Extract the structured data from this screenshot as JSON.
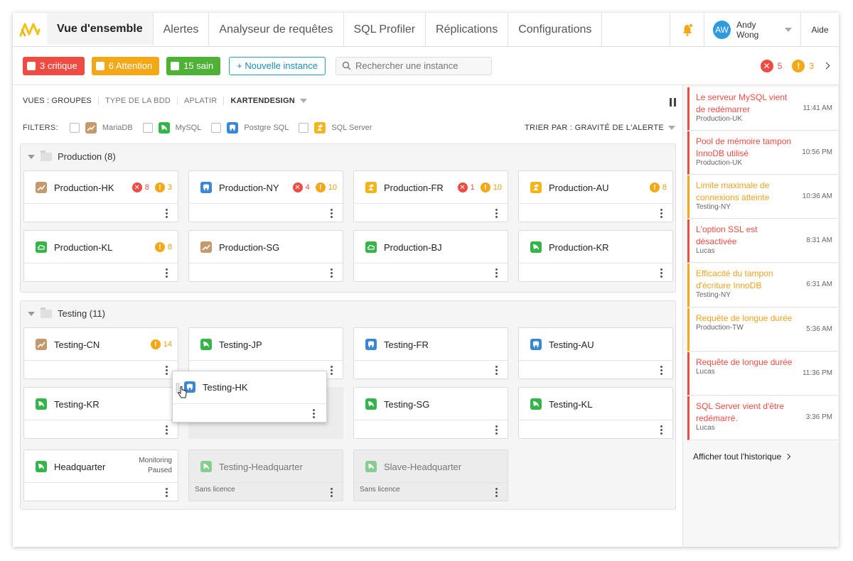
{
  "nav": {
    "tabs": [
      "Vue d'ensemble",
      "Alertes",
      "Analyseur de requêtes",
      "SQL Profiler",
      "Réplications",
      "Configurations"
    ],
    "user_initials": "AW",
    "user_name": "Andy Wong",
    "help": "Aide"
  },
  "toolbar": {
    "critical": "3 critique",
    "attention": "6 Attention",
    "healthy": "15 sain",
    "new_instance": "+ Nouvelle instance",
    "search_placeholder": "Rechercher une instance",
    "err_count": "5",
    "warn_count": "3"
  },
  "views": {
    "items": [
      "VUES : GROUPES",
      "TYPE DE LA BDD",
      "APLATIR",
      "KARTENDESIGN"
    ],
    "filters_label": "FILTERS:",
    "filters": [
      "MariaDB",
      "MySQL",
      "Postgre SQL",
      "SQL Server"
    ],
    "sort": "TRIER PAR : GRAVITÉ DE L'ALERTE"
  },
  "groups": [
    {
      "title": "Production (8)",
      "cards": [
        {
          "name": "Production-HK",
          "db": "mariadb",
          "err": "8",
          "warn": "3"
        },
        {
          "name": "Production-NY",
          "db": "postgres",
          "err": "4",
          "warn": "10"
        },
        {
          "name": "Production-FR",
          "db": "sqlserver",
          "err": "1",
          "warn": "10"
        },
        {
          "name": "Production-AU",
          "db": "sqlserver",
          "err": "",
          "warn": "8"
        },
        {
          "name": "Production-KL",
          "db": "cloud",
          "err": "",
          "warn": "8"
        },
        {
          "name": "Production-SG",
          "db": "mariadb",
          "err": "",
          "warn": ""
        },
        {
          "name": "Production-BJ",
          "db": "cloud",
          "err": "",
          "warn": ""
        },
        {
          "name": "Production-KR",
          "db": "mysql",
          "err": "",
          "warn": ""
        }
      ]
    },
    {
      "title": "Testing (11)",
      "cards": [
        {
          "name": "Testing-CN",
          "db": "mariadb",
          "err": "",
          "warn": "14"
        },
        {
          "name": "Testing-JP",
          "db": "mysql",
          "err": "",
          "warn": ""
        },
        {
          "name": "Testing-FR",
          "db": "postgres",
          "err": "",
          "warn": ""
        },
        {
          "name": "Testing-AU",
          "db": "postgres",
          "err": "",
          "warn": ""
        },
        {
          "name": "Testing-KR",
          "db": "mysql",
          "err": "",
          "warn": ""
        },
        {
          "name": "Testing-SG",
          "db": "mysql",
          "err": "",
          "warn": ""
        },
        {
          "name": "Testing-KL",
          "db": "mysql",
          "err": "",
          "warn": ""
        },
        {
          "name": "Headquarter",
          "db": "mysql",
          "err": "",
          "warn": "",
          "paused": [
            "Monitoring",
            "Paused"
          ]
        },
        {
          "name": "Testing-Headquarter",
          "db": "mysql",
          "disabled": true,
          "note": "Sans licence"
        },
        {
          "name": "Slave-Headquarter",
          "db": "mysql",
          "disabled": true,
          "note": "Sans licence"
        }
      ]
    }
  ],
  "dragging": {
    "name": "Testing-HK",
    "db": "postgres"
  },
  "history": {
    "items": [
      {
        "title": "Le serveur MySQL vient de redémarrer",
        "source": "Production-UK",
        "time": "11:41 AM",
        "level": "error"
      },
      {
        "title": "Pool de mémoire tampon InnoDB utilisé",
        "source": "Production-UK",
        "time": "10:56 PM",
        "level": "error"
      },
      {
        "title": "Limite maximale de connexions atteinte",
        "source": "Testing-NY",
        "time": "10:36 AM",
        "level": "warn"
      },
      {
        "title": "L'option SSL est désactivée",
        "source": "Lucas",
        "time": "8:31 AM",
        "level": "error"
      },
      {
        "title": "Efficacité du tampon d'écriture InnoDB",
        "source": "Testing-NY",
        "time": "6:31 AM",
        "level": "warn"
      },
      {
        "title": "Requête de longue durée",
        "source": "Production-TW",
        "time": "5:36 AM",
        "level": "warn"
      },
      {
        "title": "Requête de longue durée",
        "source": "Lucas",
        "time": "11:36 PM",
        "level": "error"
      },
      {
        "title": "SQL Server vient d'être redémarré.",
        "source": "Lucas",
        "time": "3:36 PM",
        "level": "error"
      }
    ],
    "show_all": "Afficher tout l'historique"
  },
  "colors": {
    "critical": "#ee4b42",
    "attention": "#f3a917",
    "healthy": "#4fb135",
    "accent": "#1a8fb0"
  }
}
